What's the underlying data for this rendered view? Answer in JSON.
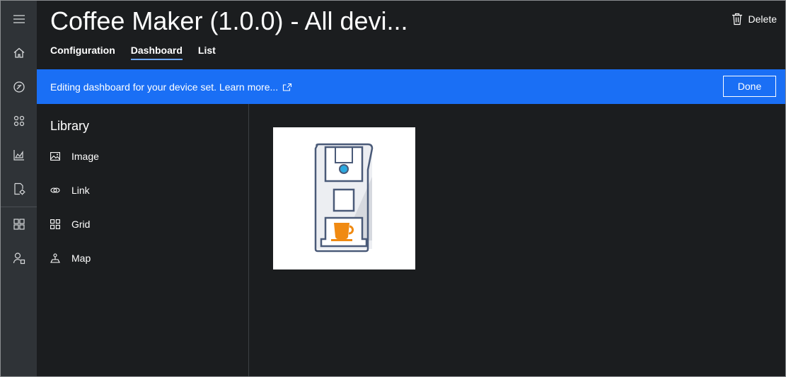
{
  "header": {
    "title": "Coffee Maker (1.0.0) - All devi...",
    "delete_label": "Delete",
    "tabs": [
      {
        "label": "Configuration",
        "active": false
      },
      {
        "label": "Dashboard",
        "active": true
      },
      {
        "label": "List",
        "active": false
      }
    ]
  },
  "banner": {
    "text": "Editing dashboard for your device set. Learn more...",
    "done_label": "Done",
    "color": "#1a6ff5"
  },
  "library": {
    "title": "Library",
    "items": [
      {
        "label": "Image",
        "icon": "image-icon"
      },
      {
        "label": "Link",
        "icon": "link-icon"
      },
      {
        "label": "Grid",
        "icon": "grid-icon"
      },
      {
        "label": "Map",
        "icon": "map-icon"
      }
    ]
  },
  "rail": {
    "icons": [
      "hamburger-icon",
      "home-icon",
      "dashboard-icon",
      "devices-icon",
      "analytics-icon",
      "device-templates-icon",
      "apps-icon",
      "admin-icon"
    ]
  },
  "canvas": {
    "tile_image": "coffee-maker-image"
  }
}
